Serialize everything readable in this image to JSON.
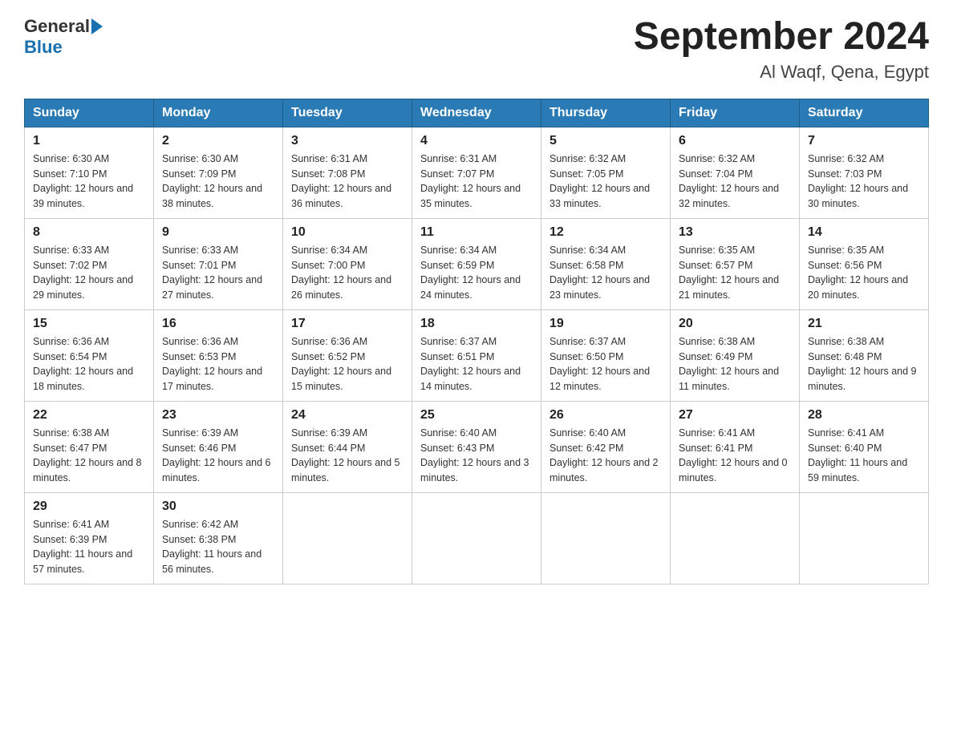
{
  "header": {
    "logo_general": "General",
    "logo_blue": "Blue",
    "title": "September 2024",
    "subtitle": "Al Waqf, Qena, Egypt"
  },
  "days_of_week": [
    "Sunday",
    "Monday",
    "Tuesday",
    "Wednesday",
    "Thursday",
    "Friday",
    "Saturday"
  ],
  "weeks": [
    [
      {
        "day": "1",
        "sunrise": "6:30 AM",
        "sunset": "7:10 PM",
        "daylight": "12 hours and 39 minutes."
      },
      {
        "day": "2",
        "sunrise": "6:30 AM",
        "sunset": "7:09 PM",
        "daylight": "12 hours and 38 minutes."
      },
      {
        "day": "3",
        "sunrise": "6:31 AM",
        "sunset": "7:08 PM",
        "daylight": "12 hours and 36 minutes."
      },
      {
        "day": "4",
        "sunrise": "6:31 AM",
        "sunset": "7:07 PM",
        "daylight": "12 hours and 35 minutes."
      },
      {
        "day": "5",
        "sunrise": "6:32 AM",
        "sunset": "7:05 PM",
        "daylight": "12 hours and 33 minutes."
      },
      {
        "day": "6",
        "sunrise": "6:32 AM",
        "sunset": "7:04 PM",
        "daylight": "12 hours and 32 minutes."
      },
      {
        "day": "7",
        "sunrise": "6:32 AM",
        "sunset": "7:03 PM",
        "daylight": "12 hours and 30 minutes."
      }
    ],
    [
      {
        "day": "8",
        "sunrise": "6:33 AM",
        "sunset": "7:02 PM",
        "daylight": "12 hours and 29 minutes."
      },
      {
        "day": "9",
        "sunrise": "6:33 AM",
        "sunset": "7:01 PM",
        "daylight": "12 hours and 27 minutes."
      },
      {
        "day": "10",
        "sunrise": "6:34 AM",
        "sunset": "7:00 PM",
        "daylight": "12 hours and 26 minutes."
      },
      {
        "day": "11",
        "sunrise": "6:34 AM",
        "sunset": "6:59 PM",
        "daylight": "12 hours and 24 minutes."
      },
      {
        "day": "12",
        "sunrise": "6:34 AM",
        "sunset": "6:58 PM",
        "daylight": "12 hours and 23 minutes."
      },
      {
        "day": "13",
        "sunrise": "6:35 AM",
        "sunset": "6:57 PM",
        "daylight": "12 hours and 21 minutes."
      },
      {
        "day": "14",
        "sunrise": "6:35 AM",
        "sunset": "6:56 PM",
        "daylight": "12 hours and 20 minutes."
      }
    ],
    [
      {
        "day": "15",
        "sunrise": "6:36 AM",
        "sunset": "6:54 PM",
        "daylight": "12 hours and 18 minutes."
      },
      {
        "day": "16",
        "sunrise": "6:36 AM",
        "sunset": "6:53 PM",
        "daylight": "12 hours and 17 minutes."
      },
      {
        "day": "17",
        "sunrise": "6:36 AM",
        "sunset": "6:52 PM",
        "daylight": "12 hours and 15 minutes."
      },
      {
        "day": "18",
        "sunrise": "6:37 AM",
        "sunset": "6:51 PM",
        "daylight": "12 hours and 14 minutes."
      },
      {
        "day": "19",
        "sunrise": "6:37 AM",
        "sunset": "6:50 PM",
        "daylight": "12 hours and 12 minutes."
      },
      {
        "day": "20",
        "sunrise": "6:38 AM",
        "sunset": "6:49 PM",
        "daylight": "12 hours and 11 minutes."
      },
      {
        "day": "21",
        "sunrise": "6:38 AM",
        "sunset": "6:48 PM",
        "daylight": "12 hours and 9 minutes."
      }
    ],
    [
      {
        "day": "22",
        "sunrise": "6:38 AM",
        "sunset": "6:47 PM",
        "daylight": "12 hours and 8 minutes."
      },
      {
        "day": "23",
        "sunrise": "6:39 AM",
        "sunset": "6:46 PM",
        "daylight": "12 hours and 6 minutes."
      },
      {
        "day": "24",
        "sunrise": "6:39 AM",
        "sunset": "6:44 PM",
        "daylight": "12 hours and 5 minutes."
      },
      {
        "day": "25",
        "sunrise": "6:40 AM",
        "sunset": "6:43 PM",
        "daylight": "12 hours and 3 minutes."
      },
      {
        "day": "26",
        "sunrise": "6:40 AM",
        "sunset": "6:42 PM",
        "daylight": "12 hours and 2 minutes."
      },
      {
        "day": "27",
        "sunrise": "6:41 AM",
        "sunset": "6:41 PM",
        "daylight": "12 hours and 0 minutes."
      },
      {
        "day": "28",
        "sunrise": "6:41 AM",
        "sunset": "6:40 PM",
        "daylight": "11 hours and 59 minutes."
      }
    ],
    [
      {
        "day": "29",
        "sunrise": "6:41 AM",
        "sunset": "6:39 PM",
        "daylight": "11 hours and 57 minutes."
      },
      {
        "day": "30",
        "sunrise": "6:42 AM",
        "sunset": "6:38 PM",
        "daylight": "11 hours and 56 minutes."
      },
      null,
      null,
      null,
      null,
      null
    ]
  ],
  "labels": {
    "sunrise": "Sunrise:",
    "sunset": "Sunset:",
    "daylight": "Daylight:"
  }
}
